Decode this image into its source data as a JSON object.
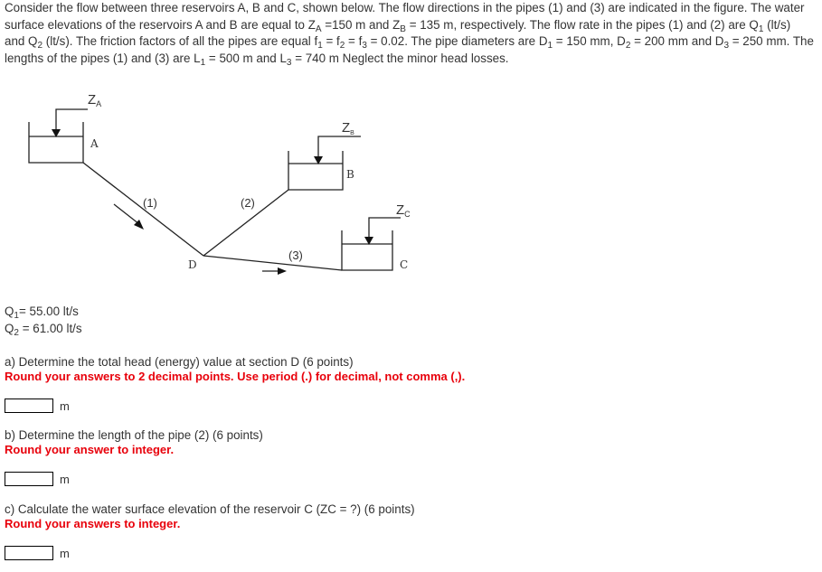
{
  "problem": {
    "seg1": "Consider the flow between three reservoirs A, B and C, shown below. The flow directions in the pipes (1) and (3) are indicated in the figure. The water surface elevations of the reservoirs A and B are equal to Z",
    "zA_sub": "A",
    "seg2": " =150 m and Z",
    "zB_sub": "B",
    "seg3": " = 135 m, respectively. The flow rate in the pipes (1) and (2) are Q",
    "q1_sub": "1",
    "seg4": " (lt/s) and Q",
    "q2_sub": "2",
    "seg5": " (lt/s). The friction factors of all the pipes are equal f",
    "f1_sub": "1",
    "seg6": " = f",
    "f2_sub": "2",
    "seg7": " = f",
    "f3_sub": "3",
    "seg8": " = 0.02. The pipe diameters are D",
    "d1_sub": "1",
    "seg9": " = 150 mm, D",
    "d2_sub": "2",
    "seg10": " = 200 mm and D",
    "d3_sub": "3",
    "seg11": " = 250 mm. The lengths of the pipes (1) and (3) are L",
    "l1_sub": "1",
    "seg12": " = 500 m and L",
    "l3_sub": "3",
    "seg13": " = 740 m Neglect the minor head losses."
  },
  "figure": {
    "zA": "Z",
    "zA_sub": "A",
    "zB": "Z",
    "zB_sub": "B",
    "zC": "Z",
    "zC_sub": "C",
    "reservoir_A": "A",
    "reservoir_B": "B",
    "reservoir_C": "C",
    "junction_D": "D",
    "pipe1": "(1)",
    "pipe2": "(2)",
    "pipe3": "(3)"
  },
  "given": {
    "q1_label": "Q",
    "q1_sub": "1",
    "q1_value": "=  55.00 lt/s",
    "q2_label": "Q",
    "q2_sub": "2",
    "q2_value": " = 61.00 lt/s"
  },
  "questions": [
    {
      "prompt": "a) Determine the total head (energy) value at section D (6 points)",
      "note": "Round your answers to 2 decimal points. Use period (.) for decimal, not comma (,).",
      "input_value": "",
      "unit": "m"
    },
    {
      "prompt": "b) Determine the length of the pipe (2) (6 points)",
      "note": "Round your answer to integer.",
      "input_value": "",
      "unit": "m"
    },
    {
      "prompt": "c) Calculate the water surface elevation of the reservoir C (ZC = ?) (6 points)",
      "note": "Round your answers to integer.",
      "input_value": "",
      "unit": "m"
    }
  ]
}
